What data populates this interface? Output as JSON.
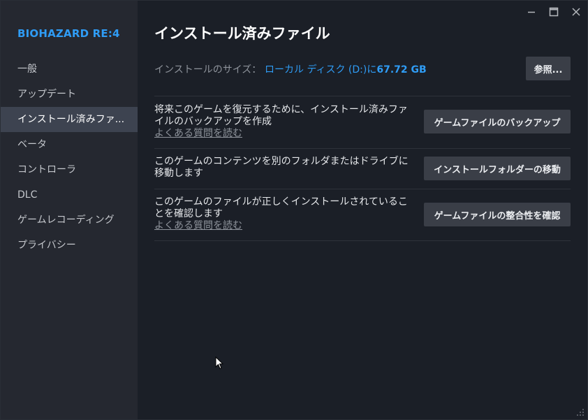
{
  "sidebar": {
    "game_title": "BIOHAZARD RE:4",
    "items": [
      {
        "label": "一般"
      },
      {
        "label": "アップデート"
      },
      {
        "label": "インストール済みファ..."
      },
      {
        "label": "ベータ"
      },
      {
        "label": "コントローラ"
      },
      {
        "label": "DLC"
      },
      {
        "label": "ゲームレコーディング"
      },
      {
        "label": "プライバシー"
      }
    ],
    "active_index": 2
  },
  "titlebar": {
    "icons": [
      "minimize-icon",
      "maximize-icon",
      "close-icon"
    ]
  },
  "main": {
    "title": "インストール済みファイル",
    "install_size": {
      "label": "インストールのサイズ：",
      "location": "ローカル ディスク (D:)に",
      "value": "67.72 GB",
      "browse_label": "参照..."
    },
    "rows": [
      {
        "text": "将来このゲームを復元するために、インストール済みファイルのバックアップを作成",
        "faq_link": "よくある質問を読む",
        "button_label": "ゲームファイルのバックアップ"
      },
      {
        "text": "このゲームのコンテンツを別のフォルダまたはドライブに移動します",
        "button_label": "インストールフォルダーの移動"
      },
      {
        "text": "このゲームのファイルが正しくインストールされていることを確認します",
        "faq_link": "よくある質問を読む",
        "button_label": "ゲームファイルの整合性を確認"
      }
    ]
  },
  "colors": {
    "accent": "#2f9cf5",
    "sidebar_bg": "#252830",
    "main_bg": "#1b1f27",
    "active_item_bg": "#3d4350",
    "button_bg": "#3a3e47"
  }
}
